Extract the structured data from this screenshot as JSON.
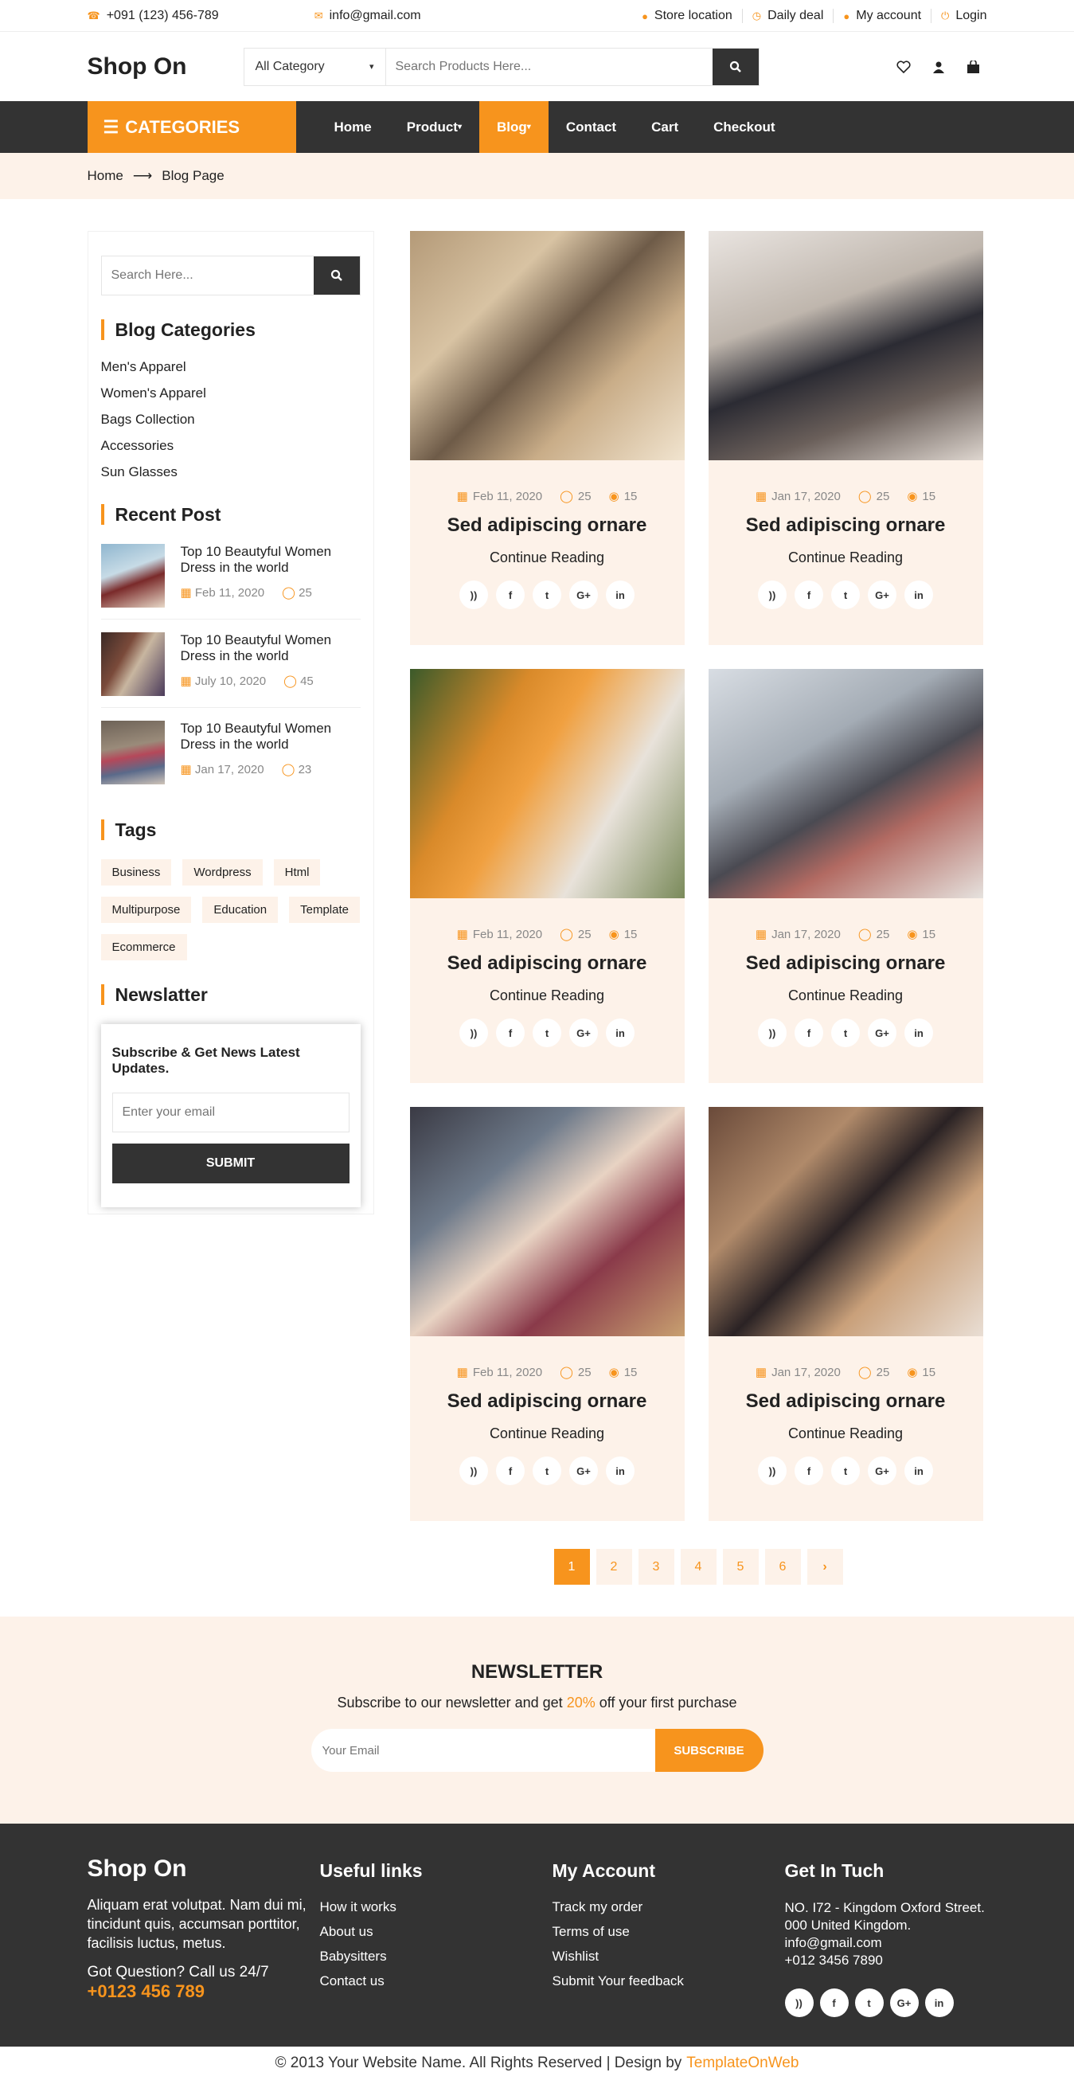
{
  "topbar": {
    "phone": "+091 (123) 456-789",
    "email": "info@gmail.com",
    "links": [
      "Store location",
      "Daily deal",
      "My account",
      "Login"
    ]
  },
  "header": {
    "logo": "Shop On",
    "category_select": "All Category",
    "search_placeholder": "Search Products Here..."
  },
  "nav": {
    "categories_label": "CATEGORIES",
    "items": [
      "Home",
      "Product",
      "Blog",
      "Contact",
      "Cart",
      "Checkout"
    ]
  },
  "breadcrumb": {
    "home": "Home",
    "current": "Blog Page"
  },
  "sidebar": {
    "search_placeholder": "Search Here...",
    "categories_title": "Blog Categories",
    "categories": [
      "Men's Apparel",
      "Women's Apparel",
      "Bags Collection",
      "Accessories",
      "Sun Glasses"
    ],
    "recent_title": "Recent Post",
    "recent": [
      {
        "title": "Top 10 Beautyful Women Dress in the world",
        "date": "Feb 11, 2020",
        "comments": "25"
      },
      {
        "title": "Top 10 Beautyful Women Dress in the world",
        "date": "July 10, 2020",
        "comments": "45"
      },
      {
        "title": "Top 10 Beautyful Women Dress in the world",
        "date": "Jan 17, 2020",
        "comments": "23"
      }
    ],
    "tags_title": "Tags",
    "tags": [
      "Business",
      "Wordpress",
      "Html",
      "Multipurpose",
      "Education",
      "Template",
      "Ecommerce"
    ],
    "newsletter_title": "Newslatter",
    "newsletter_heading": "Subscribe & Get News Latest Updates.",
    "newsletter_placeholder": "Enter your email",
    "newsletter_button": "SUBMIT"
  },
  "posts": [
    {
      "date": "Feb 11, 2020",
      "comments": "25",
      "views": "15",
      "title": "Sed adipiscing ornare",
      "link": "Continue Reading"
    },
    {
      "date": "Jan 17, 2020",
      "comments": "25",
      "views": "15",
      "title": "Sed adipiscing ornare",
      "link": "Continue Reading"
    },
    {
      "date": "Feb 11, 2020",
      "comments": "25",
      "views": "15",
      "title": "Sed adipiscing ornare",
      "link": "Continue Reading"
    },
    {
      "date": "Jan 17, 2020",
      "comments": "25",
      "views": "15",
      "title": "Sed adipiscing ornare",
      "link": "Continue Reading"
    },
    {
      "date": "Feb 11, 2020",
      "comments": "25",
      "views": "15",
      "title": "Sed adipiscing ornare",
      "link": "Continue Reading"
    },
    {
      "date": "Jan 17, 2020",
      "comments": "25",
      "views": "15",
      "title": "Sed adipiscing ornare",
      "link": "Continue Reading"
    }
  ],
  "social_icons": [
    "rss-icon",
    "facebook-icon",
    "twitter-icon",
    "google-plus-icon",
    "linkedin-icon"
  ],
  "pagination": [
    "1",
    "2",
    "3",
    "4",
    "5",
    "6"
  ],
  "newsletter": {
    "title": "NEWSLETTER",
    "sub_before": "Subscribe to our newsletter and get ",
    "sub_highlight": "20%",
    "sub_after": " off your first purchase",
    "placeholder": "Your Email",
    "button": "SUBSCRIBE"
  },
  "footer": {
    "logo": "Shop On",
    "description": "Aliquam erat volutpat. Nam dui mi, tincidunt quis, accumsan porttitor, facilisis luctus, metus.",
    "question": "Got Question? Call us 24/7",
    "phone": "+0123 456 789",
    "useful_title": "Useful links",
    "useful": [
      "How it works",
      "About us",
      "Babysitters",
      "Contact us"
    ],
    "account_title": "My Account",
    "account": [
      "Track my order",
      "Terms of use",
      "Wishlist",
      "Submit Your feedback"
    ],
    "touch_title": "Get In Tuch",
    "address": [
      "NO. I72 - Kingdom Oxford Street.",
      "000 United Kingdom.",
      "info@gmail.com",
      "+012 3456 7890"
    ]
  },
  "copyright": {
    "text": "© 2013 Your Website Name. All Rights Reserved | Design by",
    "brand": "TemplateOnWeb"
  },
  "colors": {
    "accent": "#f7941d",
    "dark": "#333333",
    "cream": "#fdf2e9"
  }
}
